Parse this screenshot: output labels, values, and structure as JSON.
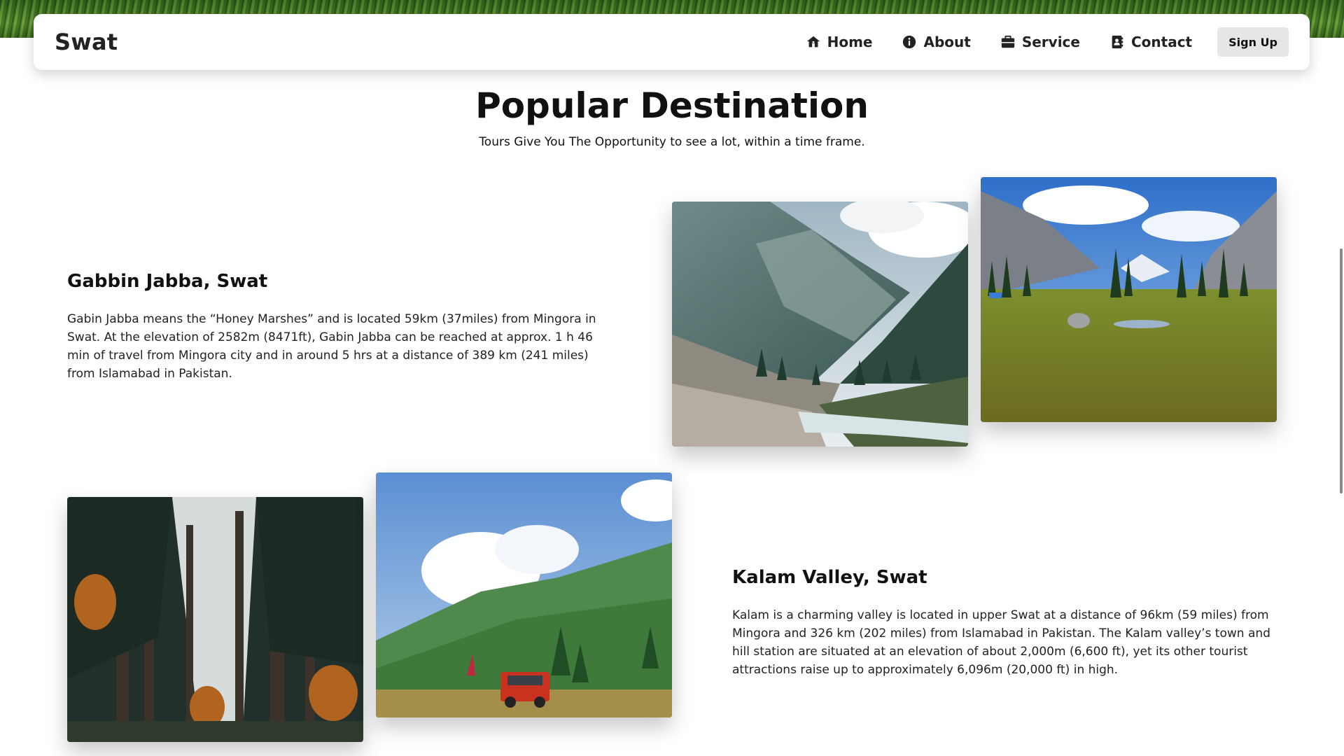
{
  "header": {
    "logo": "Swat",
    "nav": [
      {
        "label": "Home",
        "icon": "home-icon"
      },
      {
        "label": "About",
        "icon": "info-icon"
      },
      {
        "label": "Service",
        "icon": "briefcase-icon"
      },
      {
        "label": "Contact",
        "icon": "contact-book-icon"
      }
    ],
    "signup_label": "Sign Up"
  },
  "section": {
    "title": "Popular Destination",
    "subtitle": "Tours Give You The Opportunity to see a lot, within a time frame."
  },
  "destinations": [
    {
      "name": "Gabbin Jabba, Swat",
      "description": "Gabin Jabba means the “Honey Marshes” and is located 59km (37miles) from Mingora in Swat. At the elevation of 2582m (8471ft), Gabin Jabba can be reached at approx. 1 h 46 min of travel from Mingora city and in around 5 hrs at a distance of 389 km (241 miles) from Islamabad in Pakistan.",
      "photos": [
        "mountain-valley-river-photo",
        "alpine-meadow-photo"
      ]
    },
    {
      "name": "Kalam Valley, Swat",
      "description": "Kalam is a charming valley is located in upper Swat at a distance of 96km (59 miles) from Mingora and 326 km (202 miles) from Islamabad in Pakistan. The Kalam valley’s town and hill station are situated at an elevation of about 2,000m (6,600 ft), yet its other tourist attractions raise up to approximately 6,096m (20,000 ft) in high.",
      "photos": [
        "pine-forest-photo",
        "jeep-hillside-photo"
      ]
    }
  ],
  "colors": {
    "text": "#111111",
    "signup_bg": "#e6e6e6",
    "header_bg": "#ffffff"
  }
}
